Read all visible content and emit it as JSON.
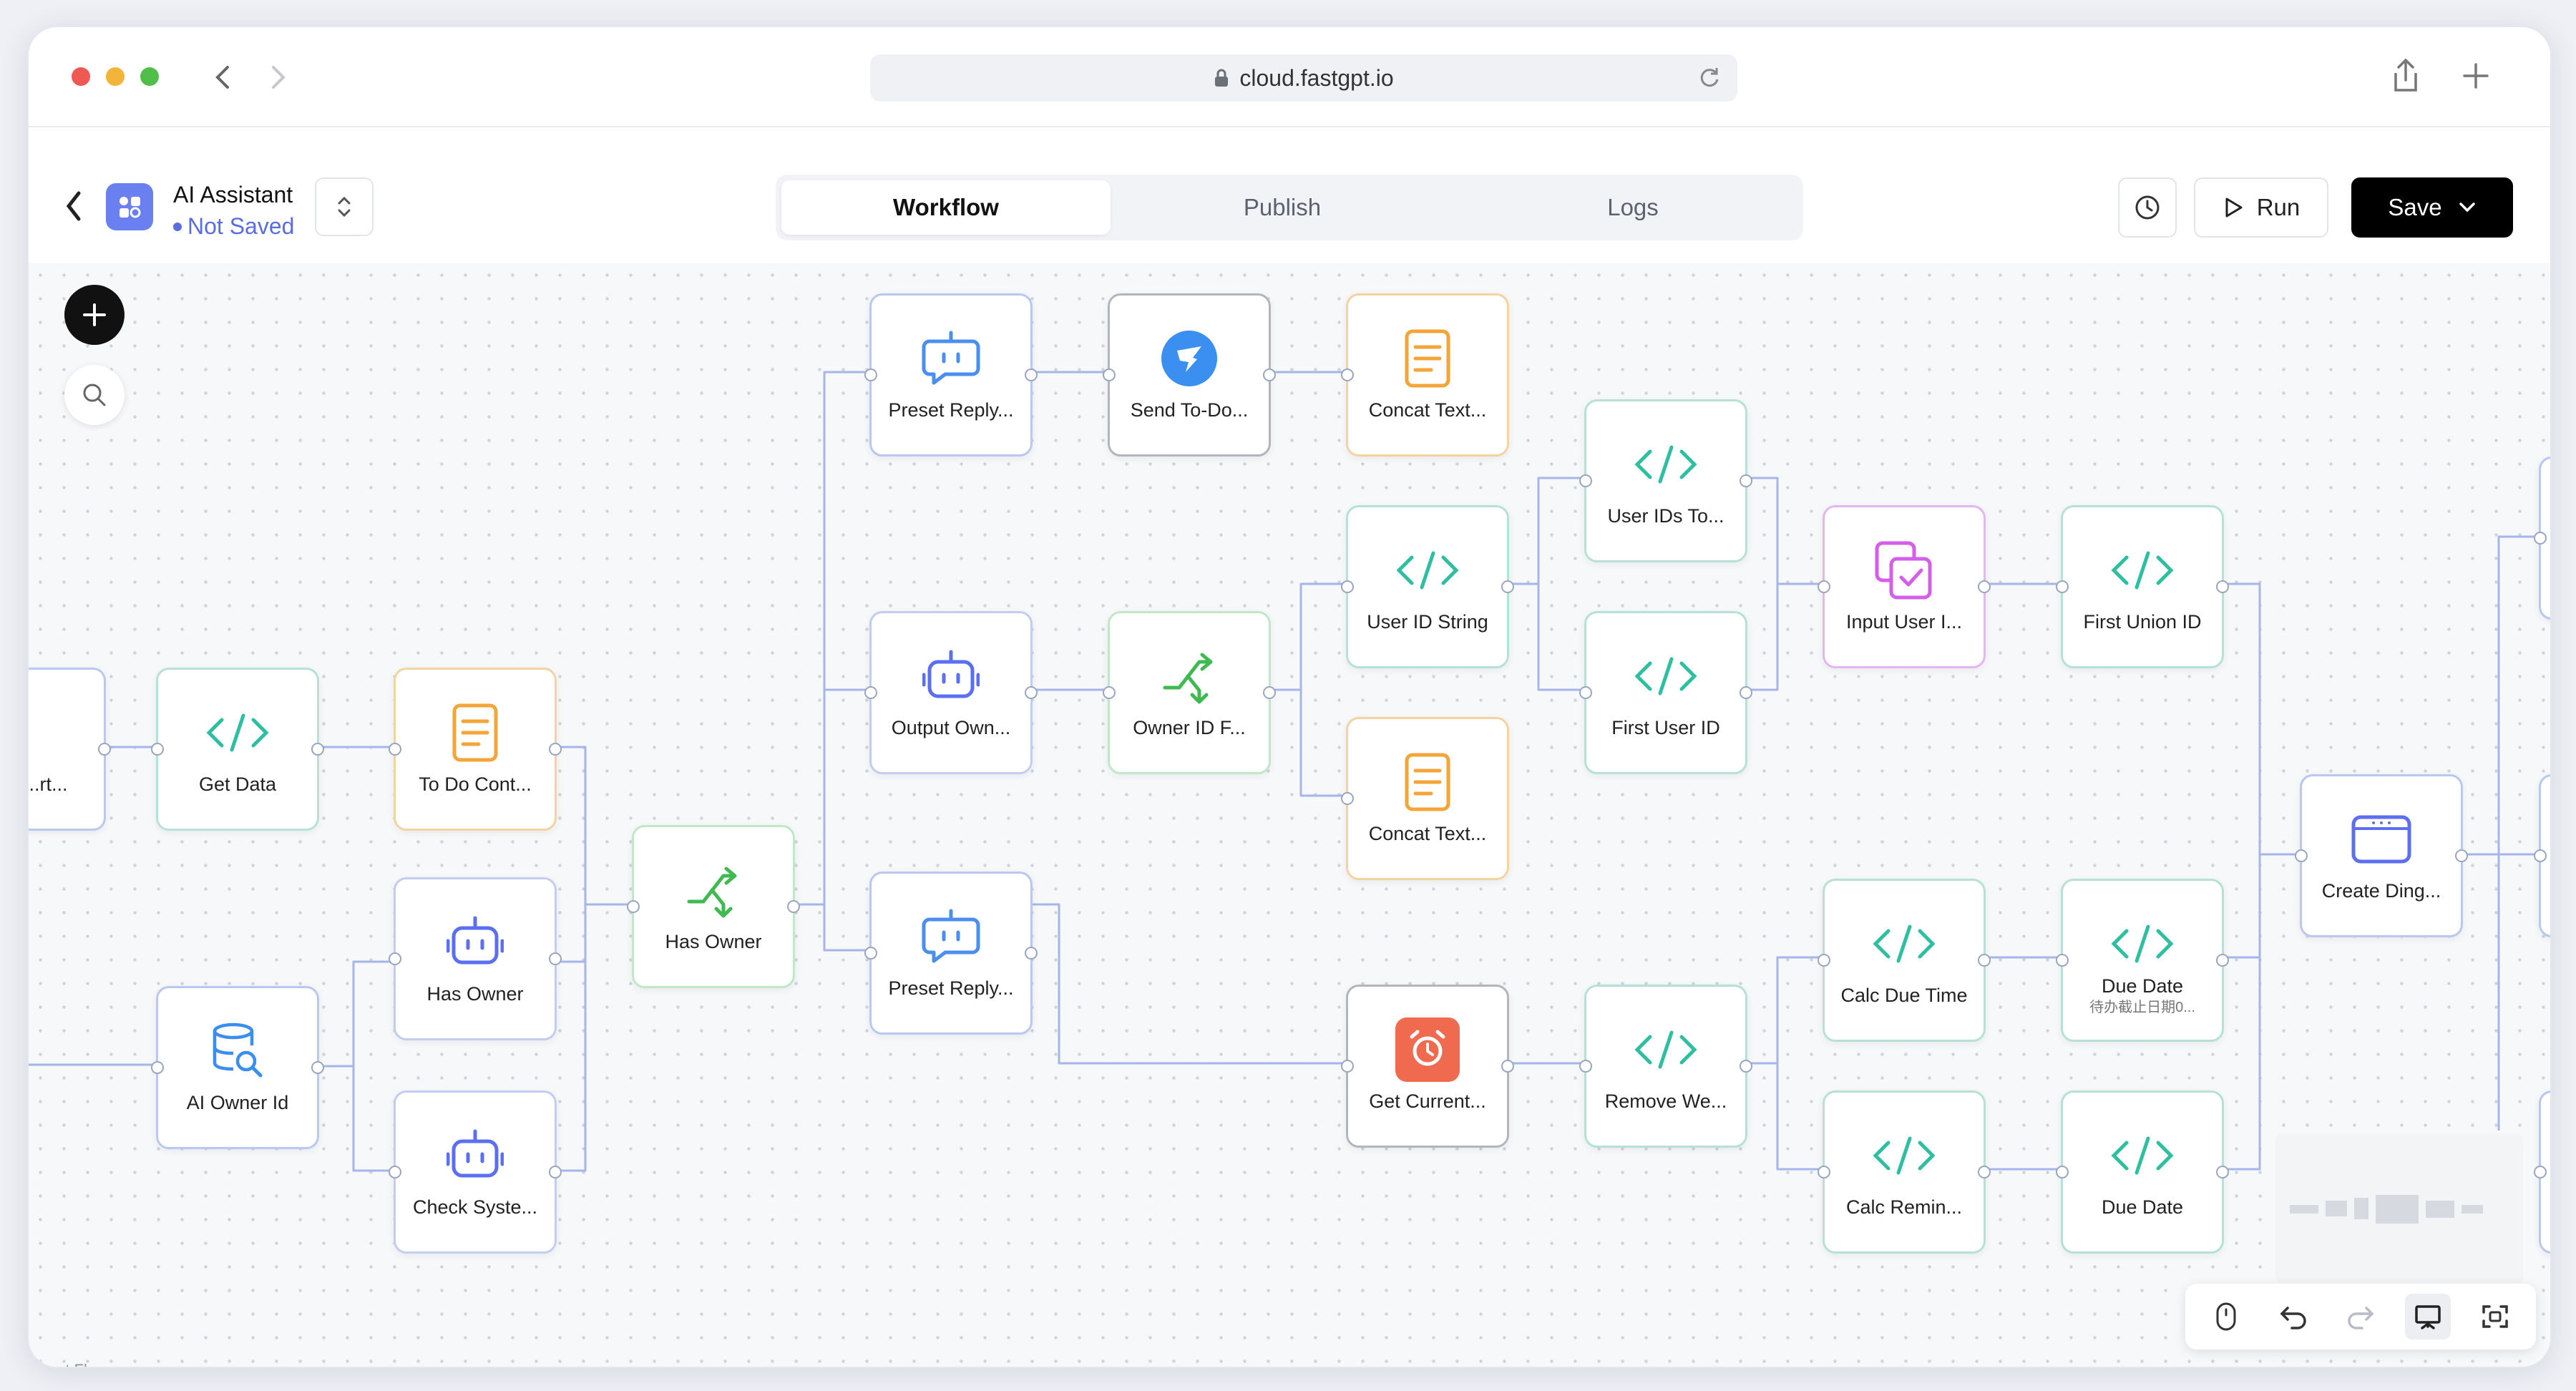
{
  "browser": {
    "url": "cloud.fastgpt.io"
  },
  "app": {
    "name": "AI Assistant",
    "status": "Not Saved"
  },
  "tabs": [
    "Workflow",
    "Publish",
    "Logs"
  ],
  "actions": {
    "run": "Run",
    "save": "Save"
  },
  "watermark": "React Flow",
  "nodes": {
    "n0": "...rt...",
    "get_data": "Get Data",
    "todo_content": "To Do Cont...",
    "ai_owner_id": "AI Owner Id",
    "has_owner_bot": "Has Owner",
    "check_system": "Check Syste...",
    "has_owner_branch": "Has Owner",
    "preset_reply_1": "Preset Reply...",
    "output_owner": "Output Own...",
    "preset_reply_2": "Preset Reply...",
    "send_todo": "Send To-Do...",
    "owner_id_filter": "Owner ID F...",
    "concat_text_1": "Concat Text...",
    "user_id_string": "User ID String",
    "concat_text_2": "Concat Text...",
    "get_current": "Get Current...",
    "user_ids_to": "User IDs To...",
    "first_user_id": "First User ID",
    "remove_weekend": "Remove We...",
    "input_user": "Input User I...",
    "calc_due_time": "Calc Due Time",
    "calc_reminder": "Calc Remin...",
    "first_union_id": "First Union ID",
    "due_date_1": "Due Date",
    "due_date_1_sub": "待办截止日期0...",
    "due_date_2": "Due Date",
    "create_ding": "Create Ding..."
  }
}
